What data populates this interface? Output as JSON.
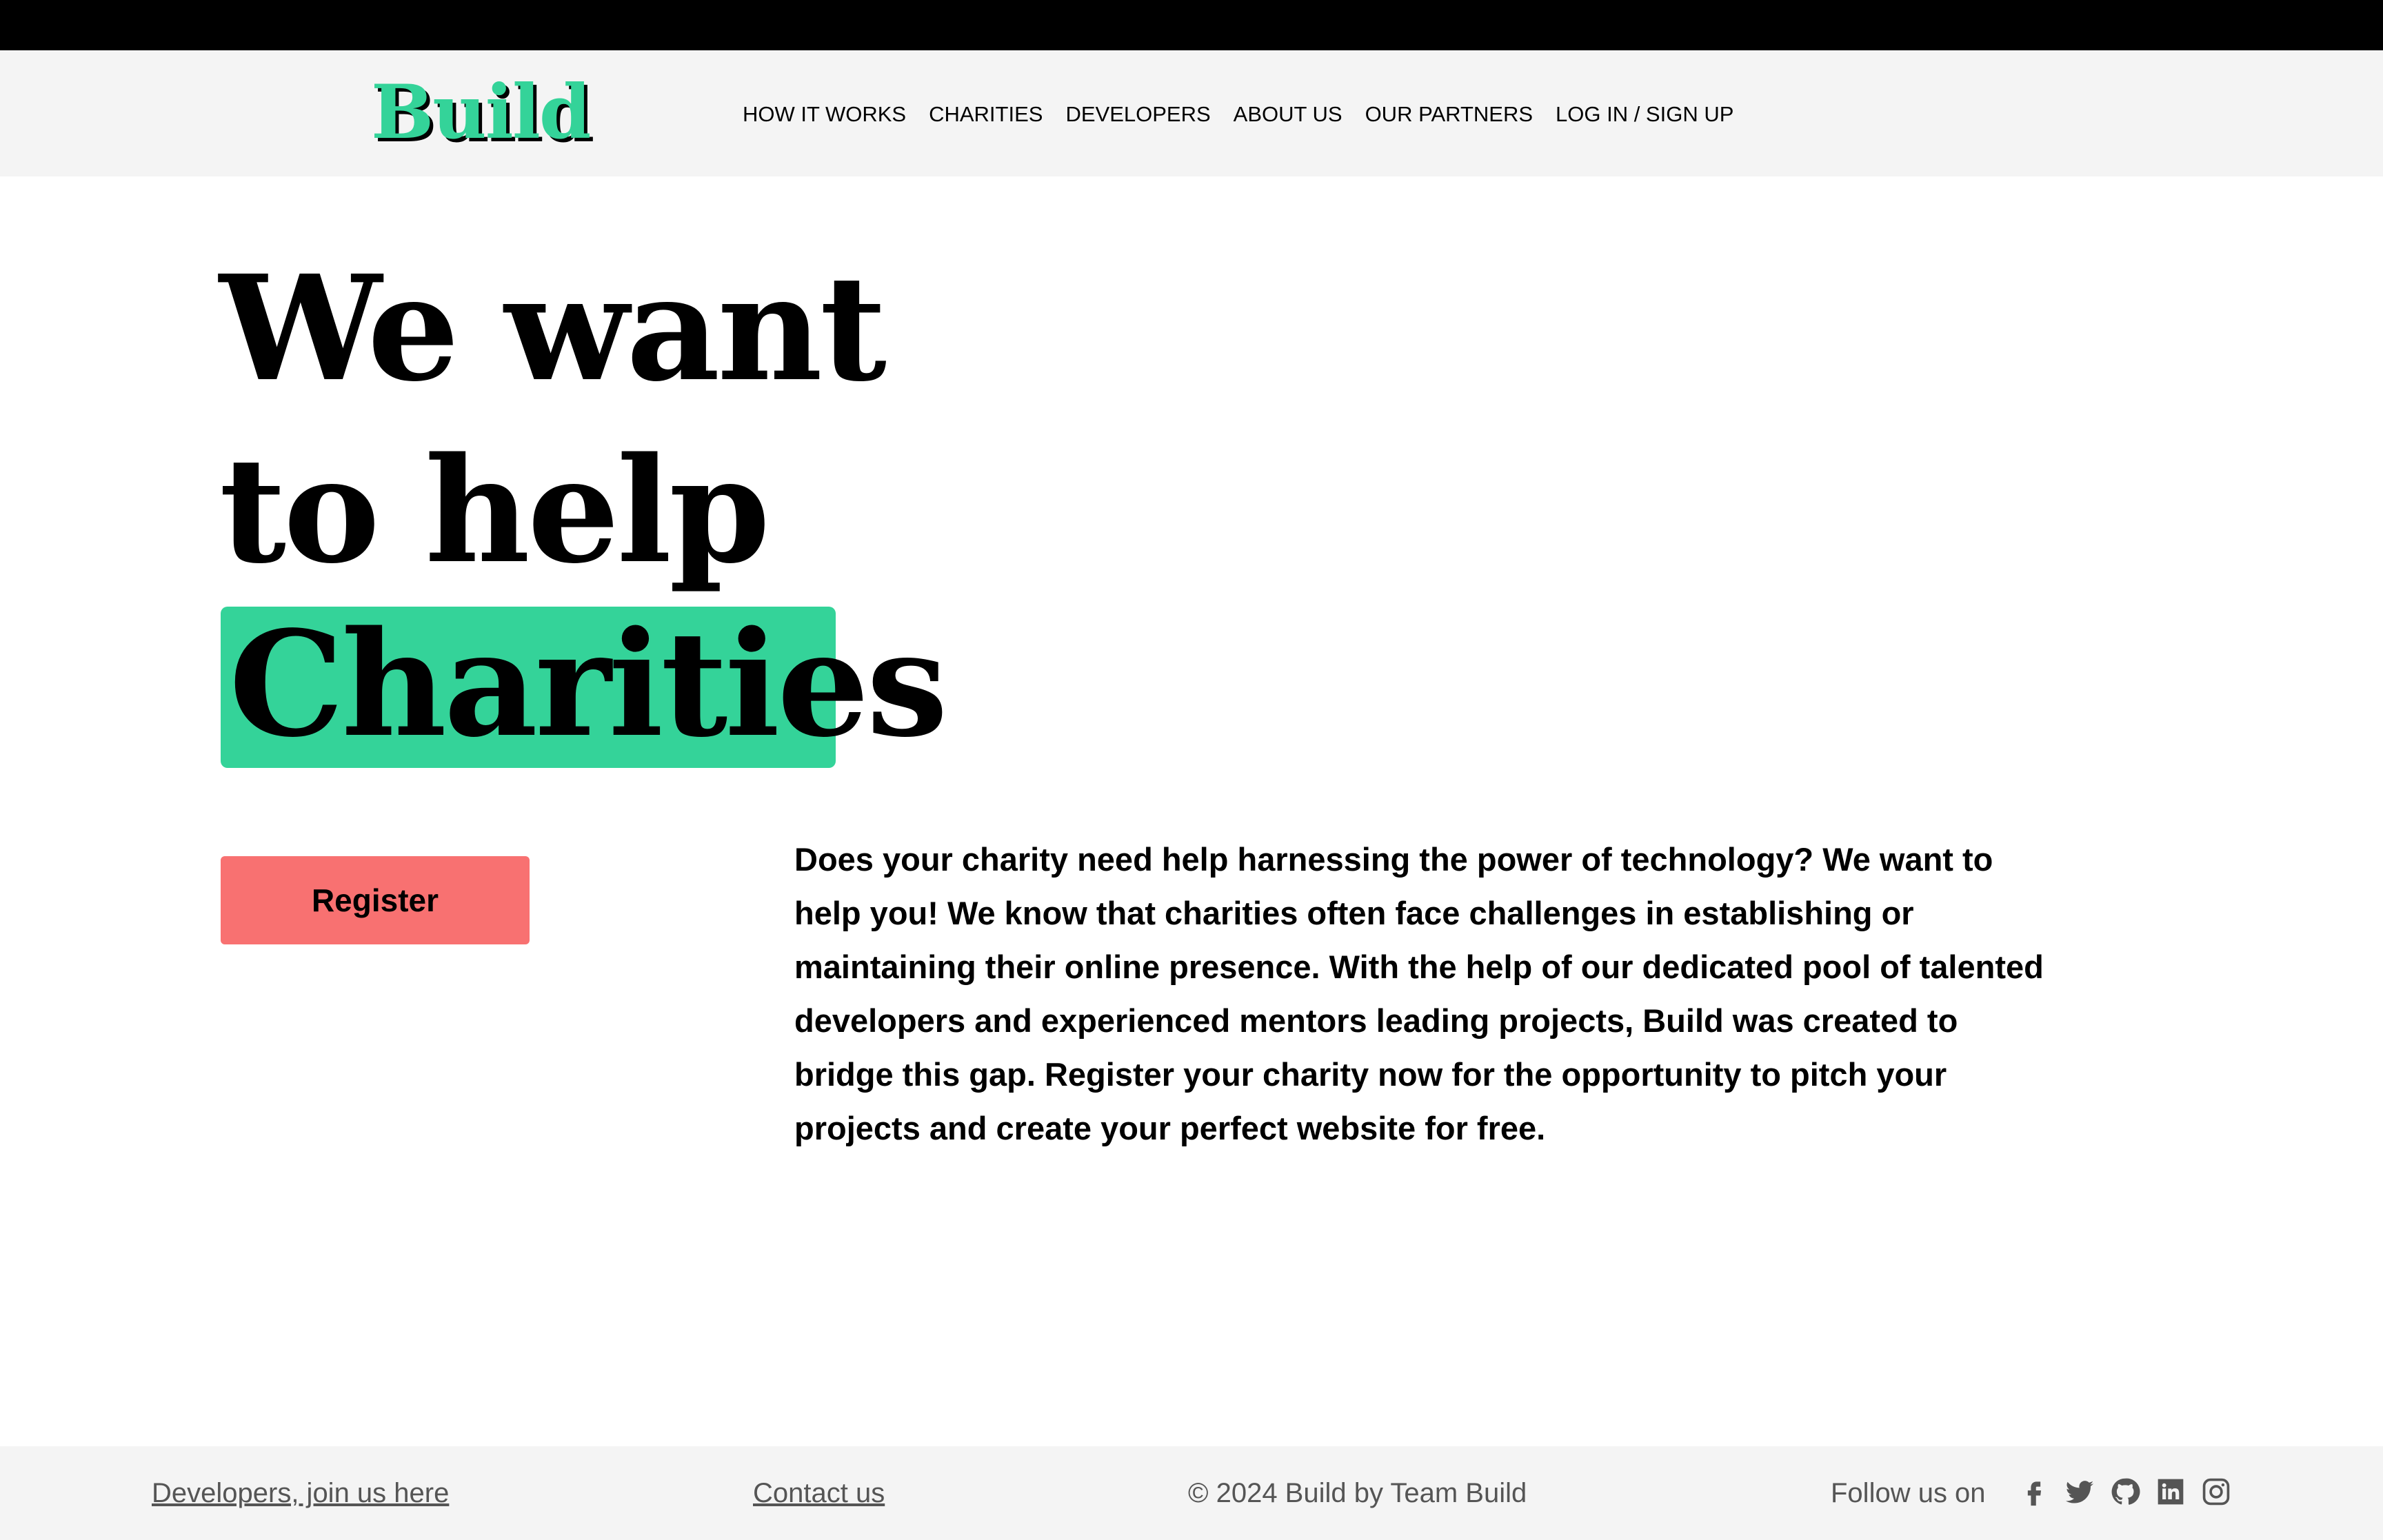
{
  "brand": {
    "logo": "Build",
    "accent_color": "#34d399",
    "button_color": "#f87171"
  },
  "nav": {
    "items": [
      {
        "label": "HOW IT WORKS"
      },
      {
        "label": "CHARITIES"
      },
      {
        "label": "DEVELOPERS"
      },
      {
        "label": "ABOUT US"
      },
      {
        "label": "OUR PARTNERS"
      },
      {
        "label": "LOG IN / SIGN UP"
      }
    ]
  },
  "hero": {
    "line1": "We want",
    "line2": "to help",
    "highlight": "Charities",
    "register_label": "Register",
    "description": "Does your charity need help harnessing the power of technology? We want to help you! We know that charities often face challenges in establishing or maintaining their online presence. With the help of our dedicated pool of talented developers and experienced mentors leading projects, Build was created to bridge this gap. Register your charity now for the opportunity to pitch your projects and create your perfect website for free."
  },
  "footer": {
    "developers_link": "Developers, join us here",
    "contact_link": "Contact us",
    "copyright": "© 2024 Build by Team Build",
    "follow_label": "Follow us on",
    "social_icons": [
      "facebook-icon",
      "twitter-icon",
      "github-icon",
      "linkedin-icon",
      "instagram-icon"
    ]
  }
}
